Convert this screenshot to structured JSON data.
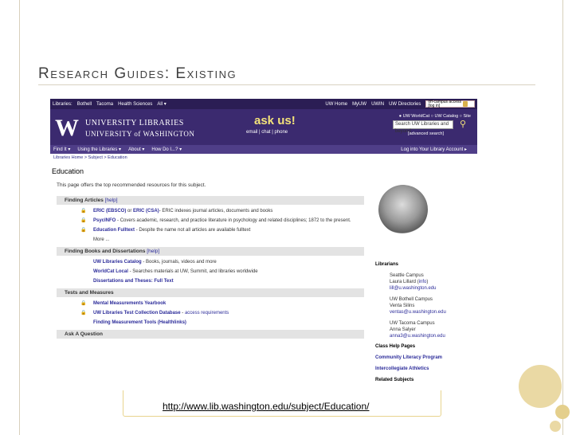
{
  "slide": {
    "title": "Research Guides: Existing",
    "url": "http://www.lib.washington.edu/subject/Education/"
  },
  "uw": {
    "topstrip": {
      "left": [
        "Libraries:",
        "Bothell",
        "Tacoma",
        "Health Sciences",
        "All ▾"
      ],
      "right": [
        "UW Home",
        "MyUW",
        "UWIN",
        "UW Directories"
      ],
      "offcampus": "off-campus access",
      "login": "[log in]"
    },
    "logo": {
      "mark": "W",
      "line1": "UNIVERSITY LIBRARIES",
      "line2": "UNIVERSITY of WASHINGTON"
    },
    "ask": {
      "title": "ask us!",
      "links": "email | chat | phone"
    },
    "search": {
      "radios": "● UW WorldCat  ○ UW Catalog  ○ Site",
      "value": "Search UW Libraries and beyond",
      "advanced": "[advanced search]"
    },
    "nav": {
      "items": [
        "Find It ▾",
        "Using the Libraries ▾",
        "About ▾",
        "How Do I...? ▾"
      ],
      "login": "Log into Your Library Account ▸"
    },
    "breadcrumb": "Libraries Home > Subject > Education",
    "page_title": "Education",
    "intro": "This page offers the top recommended resources for this subject.",
    "sections": [
      {
        "title": "Finding Articles",
        "help": "[help]",
        "items": [
          {
            "link": "ERIC (EBSCO)",
            "mid": " or ",
            "link2": "ERIC (CSA)",
            "desc": "- ERIC indexes journal articles, documents and books"
          },
          {
            "link": "PsycINFO",
            "desc": "- Covers academic, research, and practice literature in psychology and related disciplines; 1872 to the present."
          },
          {
            "link": "Education Fulltext",
            "desc": "- Despite the name not all articles are available fulltext"
          }
        ],
        "more": "More ..."
      },
      {
        "title": "Finding Books and Dissertations",
        "help": "[help]",
        "items": [
          {
            "link": "UW Libraries Catalog",
            "desc": "- Books, journals, videos and more"
          },
          {
            "link": "WorldCat Local",
            "desc": "- Searches materials at UW, Summit, and libraries worldwide"
          },
          {
            "link": "Dissertations and Theses: Full Text",
            "desc": ""
          }
        ]
      },
      {
        "title": "Tests and Measures",
        "items": [
          {
            "link": "Mental Measurements Yearbook",
            "desc": ""
          },
          {
            "link": "UW Libraries Test Collection Database",
            "desc": "- ",
            "link2": "access requirements"
          },
          {
            "link": "Finding Measurement Tools (Healthlinks)",
            "desc": ""
          }
        ]
      },
      {
        "title": "Ask A Question",
        "items": []
      }
    ],
    "right": {
      "librarians_label": "Librarians",
      "seattle": {
        "campus": "Seattle Campus",
        "name": "Laura Lillard",
        "info": "info",
        "email": "lill@u.washington.edu"
      },
      "bothell": {
        "campus": "UW Bothell Campus",
        "name": "Venta Silins",
        "email": "ventas@u.washington.edu"
      },
      "tacoma": {
        "campus": "UW Tacoma Campus",
        "name": "Anna Salyer",
        "email": "anna3@u.washington.edu"
      },
      "links": [
        "Class Help Pages",
        "Community Literacy Program",
        "Intercollegiate Athletics",
        "Related Subjects"
      ]
    }
  }
}
